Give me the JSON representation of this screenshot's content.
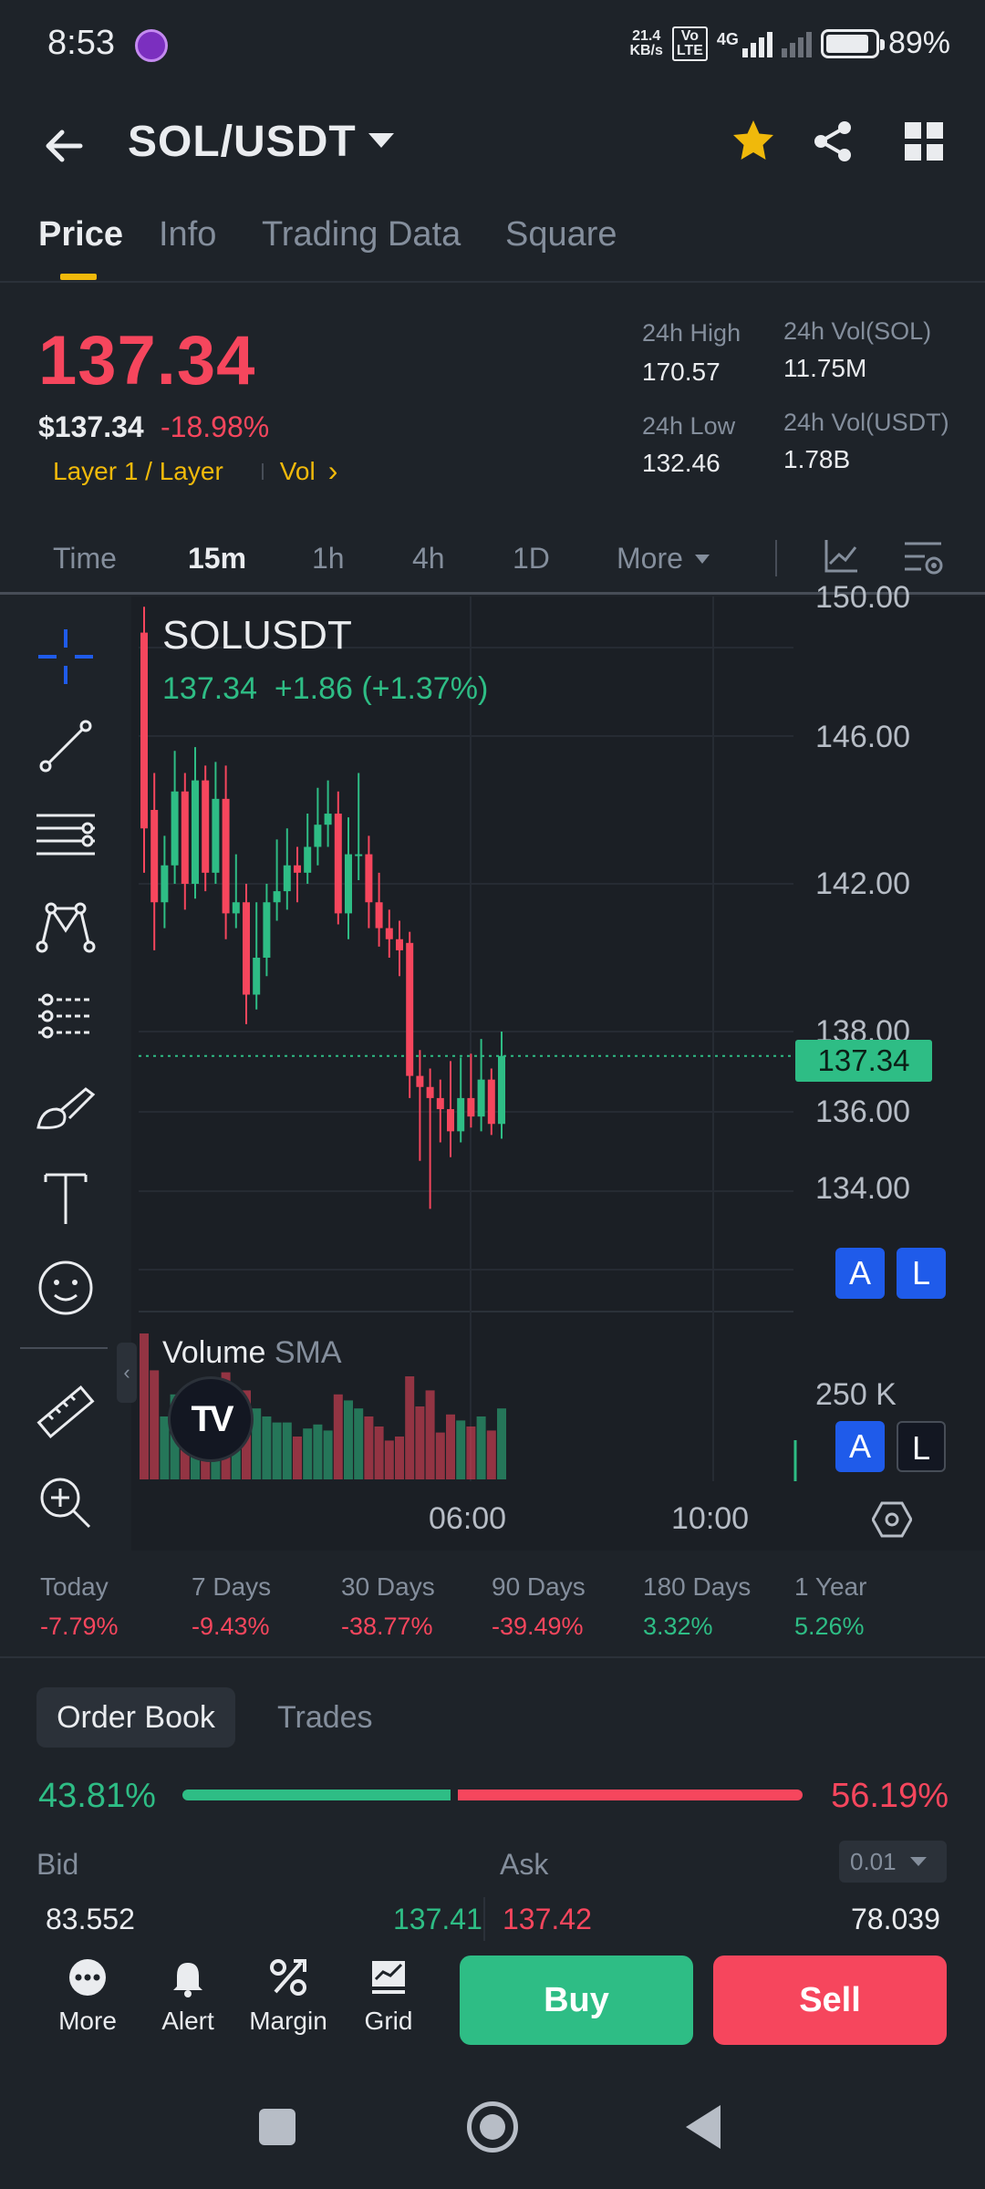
{
  "status_bar": {
    "time": "8:53",
    "net_speed_value": "21.4",
    "net_speed_unit": "KB/s",
    "volte_top": "Vo",
    "volte_bottom": "LTE",
    "network_type": "4G",
    "battery": "89%"
  },
  "header": {
    "pair": "SOL/USDT",
    "favorite": true,
    "icons": [
      "back-arrow-icon",
      "star-icon",
      "share-icon",
      "grid-icon"
    ]
  },
  "tabs": [
    {
      "label": "Price",
      "active": true
    },
    {
      "label": "Info",
      "active": false
    },
    {
      "label": "Trading Data",
      "active": false
    },
    {
      "label": "Square",
      "active": false
    }
  ],
  "price": {
    "last": "137.34",
    "usd": "$137.34",
    "change_pct": "-18.98%",
    "tag": "Layer 1 / Layer",
    "vol_link": "Vol",
    "vol_chevron": "›"
  },
  "stats": {
    "high_label": "24h High",
    "high_value": "170.57",
    "low_label": "24h Low",
    "low_value": "132.46",
    "vol_sol_label": "24h Vol(SOL)",
    "vol_sol_value": "11.75M",
    "vol_usdt_label": "24h Vol(USDT)",
    "vol_usdt_value": "1.78B"
  },
  "intervals": [
    {
      "label": "Time",
      "active": false
    },
    {
      "label": "15m",
      "active": true
    },
    {
      "label": "1h",
      "active": false
    },
    {
      "label": "4h",
      "active": false
    },
    {
      "label": "1D",
      "active": false
    },
    {
      "label": "More",
      "active": false
    }
  ],
  "chart": {
    "symbol": "SOLUSDT",
    "quote_line": "137.34  +1.86 (+1.37%)",
    "price_ticks": [
      "150.00",
      "146.00",
      "142.00",
      "138.00",
      "136.00",
      "134.00"
    ],
    "current_price_marker": "137.34",
    "volume_label": "Volume",
    "volume_sma": "SMA",
    "volume_tick": "250 K",
    "time_ticks": [
      "06:00",
      "10:00"
    ],
    "alert_btn": "A",
    "log_btn": "L",
    "logo_text": "TV",
    "collapse_glyph": "‹"
  },
  "chart_data": {
    "type": "candlestick",
    "symbol": "SOLUSDT",
    "interval": "15m",
    "y_axis_ticks": [
      150,
      146,
      142,
      138,
      136,
      134
    ],
    "x_axis_ticks": [
      "06:00",
      "10:00"
    ],
    "last_price": 137.34,
    "candles": [
      {
        "o": 148.8,
        "c": 143.5,
        "h": 149.5,
        "l": 142.3
      },
      {
        "o": 144.0,
        "c": 141.5,
        "h": 145.0,
        "l": 140.2
      },
      {
        "o": 141.5,
        "c": 142.5,
        "h": 143.3,
        "l": 140.8
      },
      {
        "o": 142.5,
        "c": 144.5,
        "h": 145.6,
        "l": 142.0
      },
      {
        "o": 144.5,
        "c": 142.0,
        "h": 145.0,
        "l": 141.3
      },
      {
        "o": 142.0,
        "c": 144.8,
        "h": 145.7,
        "l": 141.6
      },
      {
        "o": 144.8,
        "c": 142.3,
        "h": 145.2,
        "l": 141.8
      },
      {
        "o": 142.3,
        "c": 144.3,
        "h": 145.3,
        "l": 142.0
      },
      {
        "o": 144.3,
        "c": 141.2,
        "h": 145.2,
        "l": 140.5
      },
      {
        "o": 141.2,
        "c": 141.5,
        "h": 142.8,
        "l": 140.8
      },
      {
        "o": 141.5,
        "c": 139.0,
        "h": 142.0,
        "l": 138.2
      },
      {
        "o": 139.0,
        "c": 140.0,
        "h": 141.5,
        "l": 138.6
      },
      {
        "o": 140.0,
        "c": 141.5,
        "h": 142.0,
        "l": 139.5
      },
      {
        "o": 141.5,
        "c": 141.8,
        "h": 143.2,
        "l": 141.0
      },
      {
        "o": 141.8,
        "c": 142.5,
        "h": 143.5,
        "l": 141.3
      },
      {
        "o": 142.5,
        "c": 142.3,
        "h": 143.0,
        "l": 141.5
      },
      {
        "o": 142.3,
        "c": 143.0,
        "h": 143.9,
        "l": 142.0
      },
      {
        "o": 143.0,
        "c": 143.6,
        "h": 144.6,
        "l": 142.5
      },
      {
        "o": 143.6,
        "c": 143.9,
        "h": 144.8,
        "l": 143.0
      },
      {
        "o": 143.9,
        "c": 141.2,
        "h": 144.5,
        "l": 140.9
      },
      {
        "o": 141.2,
        "c": 142.8,
        "h": 143.8,
        "l": 140.5
      },
      {
        "o": 142.8,
        "c": 142.8,
        "h": 145.0,
        "l": 142.1
      },
      {
        "o": 142.8,
        "c": 141.5,
        "h": 143.3,
        "l": 140.8
      },
      {
        "o": 141.5,
        "c": 140.8,
        "h": 142.3,
        "l": 140.3
      },
      {
        "o": 140.8,
        "c": 140.5,
        "h": 141.3,
        "l": 140.0
      },
      {
        "o": 140.5,
        "c": 140.2,
        "h": 141.0,
        "l": 139.5
      },
      {
        "o": 140.4,
        "c": 136.8,
        "h": 140.7,
        "l": 136.2
      },
      {
        "o": 136.8,
        "c": 136.5,
        "h": 137.5,
        "l": 134.5
      },
      {
        "o": 136.5,
        "c": 136.2,
        "h": 137.0,
        "l": 133.2
      },
      {
        "o": 136.2,
        "c": 135.9,
        "h": 136.7,
        "l": 135.0
      },
      {
        "o": 135.9,
        "c": 135.3,
        "h": 137.2,
        "l": 134.6
      },
      {
        "o": 135.3,
        "c": 136.2,
        "h": 137.3,
        "l": 135.0
      },
      {
        "o": 136.2,
        "c": 135.7,
        "h": 137.4,
        "l": 135.4
      },
      {
        "o": 135.7,
        "c": 136.7,
        "h": 137.8,
        "l": 135.3
      },
      {
        "o": 136.7,
        "c": 135.5,
        "h": 137.0,
        "l": 135.2
      },
      {
        "o": 135.5,
        "c": 137.34,
        "h": 138.0,
        "l": 135.1
      }
    ],
    "volume_tick": "250 K"
  },
  "performance": [
    {
      "label": "Today",
      "value": "-7.79%",
      "dir": "down"
    },
    {
      "label": "7 Days",
      "value": "-9.43%",
      "dir": "down"
    },
    {
      "label": "30 Days",
      "value": "-38.77%",
      "dir": "down"
    },
    {
      "label": "90 Days",
      "value": "-39.49%",
      "dir": "down"
    },
    {
      "label": "180 Days",
      "value": "3.32%",
      "dir": "up"
    },
    {
      "label": "1 Year",
      "value": "5.26%",
      "dir": "up"
    }
  ],
  "order_book": {
    "tab_active": "Order Book",
    "tab_inactive": "Trades",
    "bid_pct": "43.81%",
    "ask_pct": "56.19%",
    "bid_ratio": 43.81,
    "bid_label": "Bid",
    "ask_label": "Ask",
    "depth": "0.01",
    "rows": [
      {
        "bid_qty": "83.552",
        "bid_price": "137.41",
        "ask_price": "137.42",
        "ask_qty": "78.039"
      }
    ]
  },
  "actions": {
    "more": "More",
    "alert": "Alert",
    "margin": "Margin",
    "grid": "Grid",
    "buy": "Buy",
    "sell": "Sell"
  },
  "colors": {
    "background": "#1e2329",
    "up": "#2ebd85",
    "down": "#f6465d",
    "accent": "#f0b90b",
    "tool_blue": "#1f5bea"
  }
}
